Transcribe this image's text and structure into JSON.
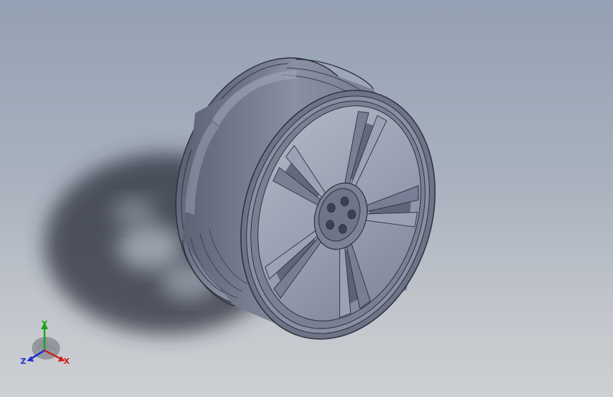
{
  "viewport": {
    "background_top": "#94a0b3",
    "background_bottom": "#cdd0d3"
  },
  "model": {
    "name": "wheel-rim",
    "spoke_pairs": 5,
    "lug_holes": 5,
    "rim_color": "#787e93",
    "rim_light": "#9ca2b5",
    "rim_dark": "#4f5466",
    "edge_color": "#2c2f3a"
  },
  "triad": {
    "x_label": "X",
    "y_label": "Y",
    "z_label": "Z",
    "x_color": "#d11f1f",
    "y_color": "#19a31b",
    "z_color": "#1f2ed1"
  }
}
